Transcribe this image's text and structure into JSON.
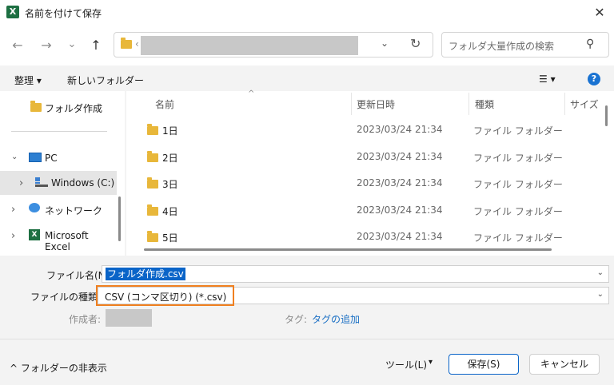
{
  "window": {
    "title": "名前を付けて保存",
    "app_icon_letter": "X",
    "close_glyph": "✕"
  },
  "nav": {
    "back": "←",
    "forward": "→",
    "recent": "⌄",
    "up": "↑",
    "path_prefix": "‹",
    "address_dropdown": "⌄",
    "refresh": "↻",
    "search_placeholder": "フォルダ大量作成の検索",
    "search_glyph": "⚲"
  },
  "toolbar": {
    "organize": "整理 ▾",
    "new_folder": "新しいフォルダー",
    "view": "☰ ▾",
    "help": "?"
  },
  "left_nav": {
    "items": [
      {
        "label": "フォルダ作成",
        "chevron": ""
      },
      {
        "label": "PC",
        "chevron": "⌄"
      },
      {
        "label": "Windows (C:)",
        "chevron": "›"
      },
      {
        "label": "ネットワーク",
        "chevron": "›"
      },
      {
        "label": "Microsoft Excel",
        "chevron": "›"
      }
    ]
  },
  "columns": {
    "name": "名前",
    "date": "更新日時",
    "type": "種類",
    "size": "サイズ",
    "sort_glyph": "^"
  },
  "files": [
    {
      "name": "1日",
      "date": "2023/03/24 21:34",
      "type": "ファイル フォルダー"
    },
    {
      "name": "2日",
      "date": "2023/03/24 21:34",
      "type": "ファイル フォルダー"
    },
    {
      "name": "3日",
      "date": "2023/03/24 21:34",
      "type": "ファイル フォルダー"
    },
    {
      "name": "4日",
      "date": "2023/03/24 21:34",
      "type": "ファイル フォルダー"
    },
    {
      "name": "5日",
      "date": "2023/03/24 21:34",
      "type": "ファイル フォルダー"
    }
  ],
  "form": {
    "filename_label": "ファイル名(N):",
    "filename_value": "フォルダ作成.csv",
    "filetype_label": "ファイルの種類(T):",
    "filetype_value": "CSV (コンマ区切り) (*.csv)",
    "author_label": "作成者:",
    "tags_label": "タグ:",
    "tags_link": "タグの追加",
    "combo_chevron": "⌄"
  },
  "footer": {
    "hide_folders": "^  フォルダーの非表示",
    "tools": "ツール(L)",
    "tools_arrow": "▾",
    "save": "保存(S)",
    "cancel": "キャンセル"
  },
  "colors": {
    "accent": "#0a64c8",
    "highlight_border": "#f08020",
    "folder": "#e8b73a"
  }
}
